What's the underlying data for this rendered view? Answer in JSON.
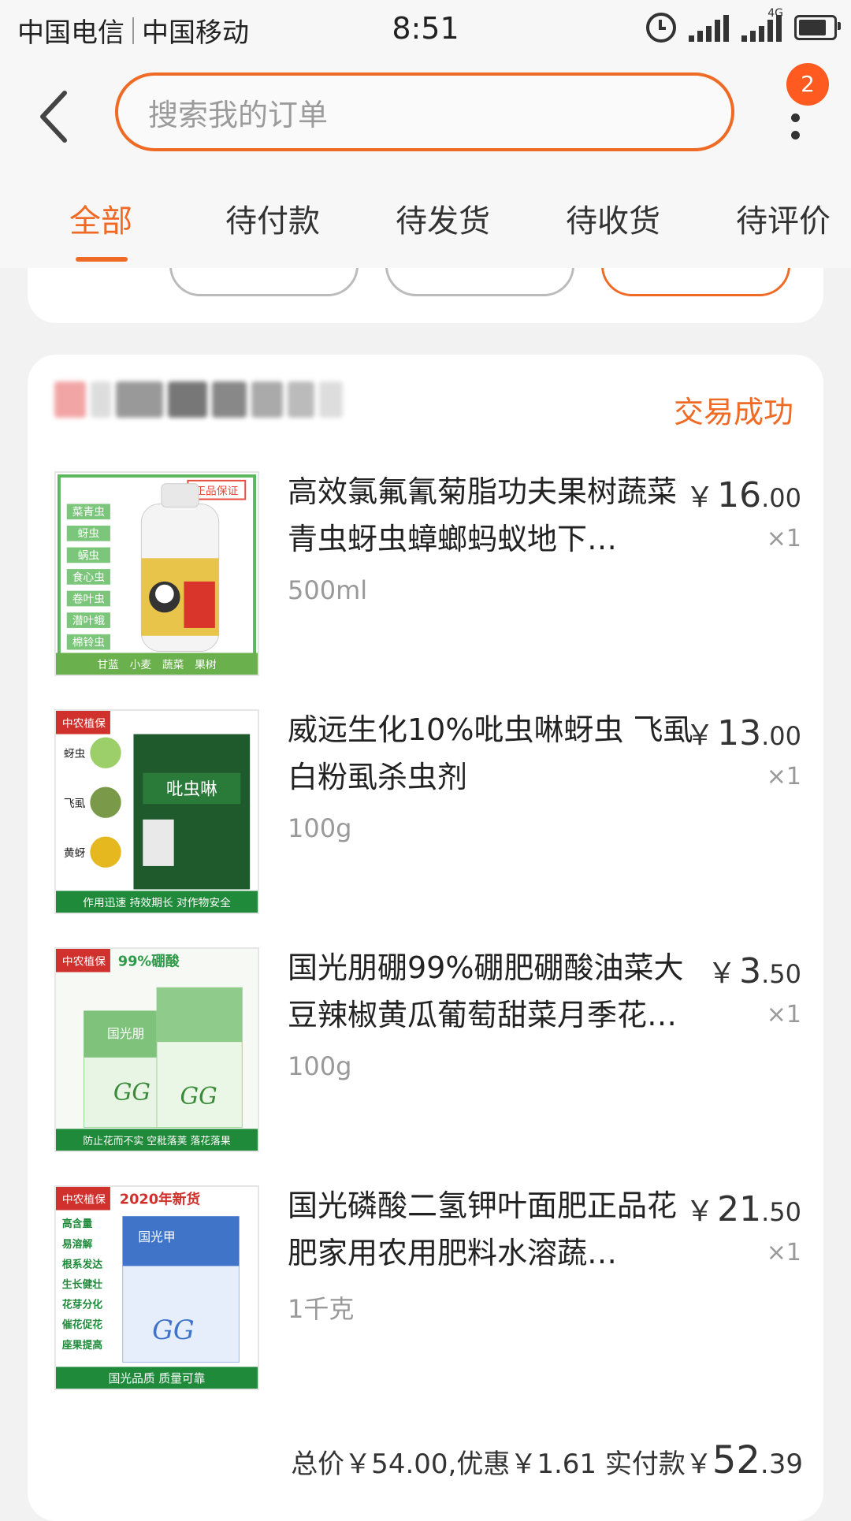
{
  "status_bar": {
    "carrier1": "中国电信",
    "carrier2": "中国移动",
    "time": "8:51",
    "network_label": "4G"
  },
  "header": {
    "search_placeholder": "搜索我的订单",
    "badge_count": "2"
  },
  "tabs": [
    {
      "label": "全部",
      "active": true
    },
    {
      "label": "待付款",
      "active": false
    },
    {
      "label": "待发货",
      "active": false
    },
    {
      "label": "待收货",
      "active": false
    },
    {
      "label": "待评价",
      "active": false
    }
  ],
  "order": {
    "status": "交易成功",
    "currency": "￥",
    "items": [
      {
        "title": "高效氯氟氰菊脂功夫果树蔬菜青虫蚜虫蟑螂蚂蚁地下…",
        "spec": "500ml",
        "price_int": "16",
        "price_dec": ".00",
        "qty": "×1",
        "thumb_text": [
          "菜青虫",
          "蚜虫",
          "蜗虫",
          "食心虫",
          "卷叶虫",
          "潜叶蛾",
          "棉铃虫"
        ],
        "thumb_badge": "正品保证",
        "thumb_footer": "甘蓝　小麦　蔬菜　果树"
      },
      {
        "title": "威远生化10%吡虫啉蚜虫 飞虱 白粉虱杀虫剂",
        "spec": "100g",
        "price_int": "13",
        "price_dec": ".00",
        "qty": "×1",
        "thumb_brand": "中农植保",
        "thumb_labels": [
          "蚜虫",
          "飞虱",
          "黄蚜"
        ],
        "thumb_product": "吡虫啉",
        "thumb_footer": "作用迅速 持效期长 对作物安全"
      },
      {
        "title": "国光朋硼99%硼肥硼酸油菜大豆辣椒黄瓜葡萄甜菜月季花…",
        "spec": "100g",
        "price_int": "3",
        "price_dec": ".50",
        "qty": "×1",
        "thumb_brand": "中农植保",
        "thumb_header": "99%硼酸",
        "thumb_product": "国光朋",
        "thumb_footer": "防止花而不实  空秕落荚  落花落果"
      },
      {
        "title": "国光磷酸二氢钾叶面肥正品花肥家用农用肥料水溶蔬…",
        "spec": "1千克",
        "price_int": "21",
        "price_dec": ".50",
        "qty": "×1",
        "thumb_brand": "中农植保",
        "thumb_header": "2020年新货",
        "thumb_labels": [
          "高含量",
          "易溶解",
          "根系发达",
          "生长健壮",
          "花芽分化",
          "催花促花",
          "座果提高"
        ],
        "thumb_product": "国光甲",
        "thumb_footer": "国光品质  质量可靠"
      }
    ],
    "total_label": "总价￥54.00,优惠￥1.61 实付款",
    "paid_int": "52",
    "paid_dec": ".39"
  },
  "colors": {
    "accent": "#ef6a24",
    "badge": "#ff5a1f",
    "thumb_green": "#2e9a4a"
  }
}
